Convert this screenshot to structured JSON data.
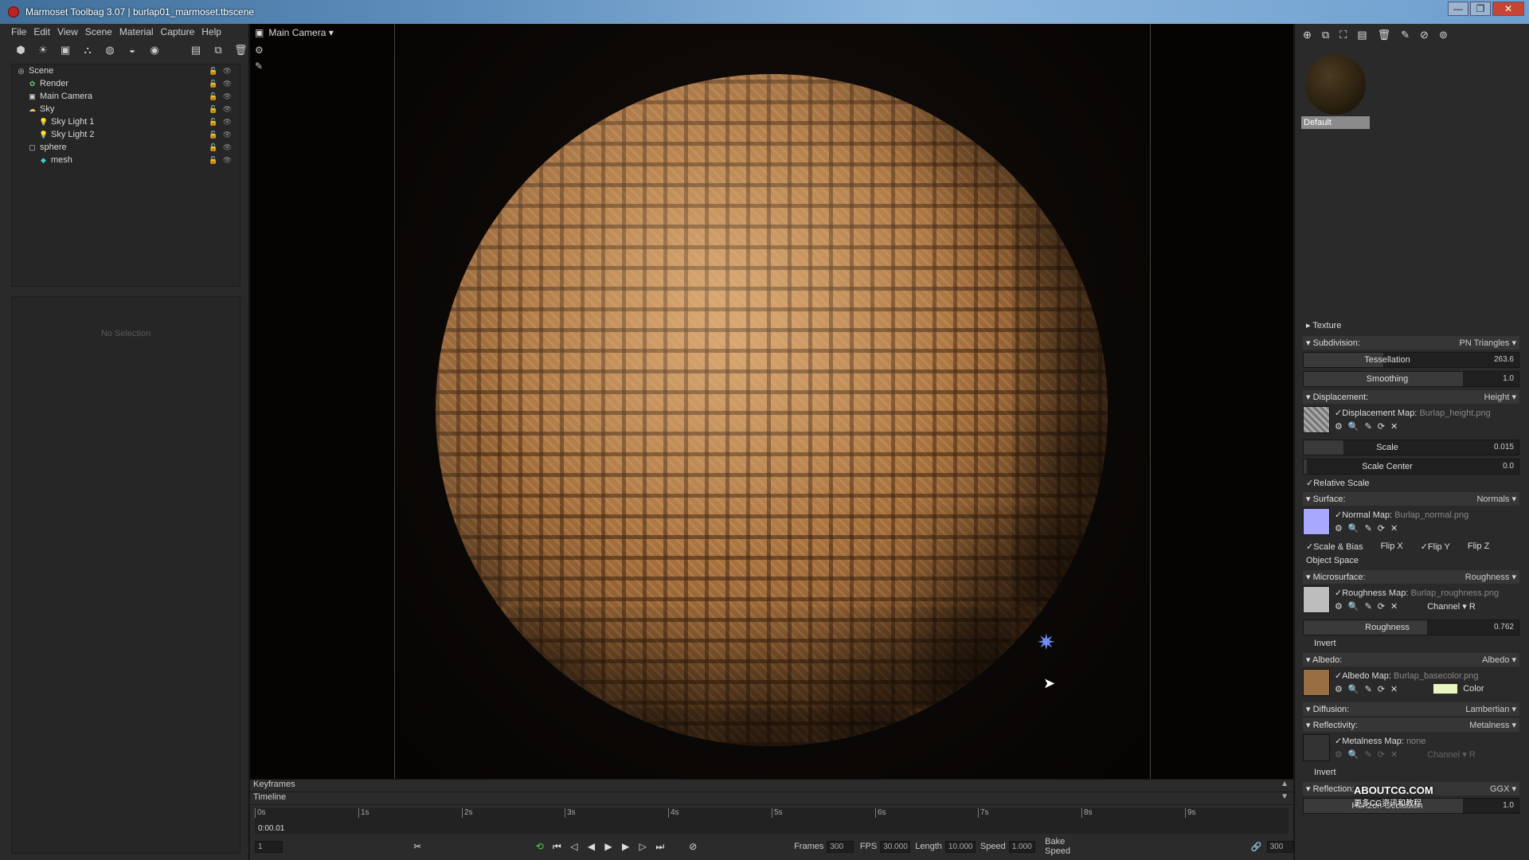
{
  "window": {
    "title": "Marmoset Toolbag 3.07  |  burlap01_marmoset.tbscene",
    "minimize": "—",
    "maximize": "❐",
    "close": "✕"
  },
  "menu": [
    "File",
    "Edit",
    "View",
    "Scene",
    "Material",
    "Capture",
    "Help"
  ],
  "scene_tree": [
    {
      "name": "Scene",
      "depth": 0,
      "icon": "scene-icon"
    },
    {
      "name": "Render",
      "depth": 1,
      "icon": "render-icon"
    },
    {
      "name": "Main Camera",
      "depth": 1,
      "icon": "camera-icon"
    },
    {
      "name": "Sky",
      "depth": 1,
      "icon": "sky-icon"
    },
    {
      "name": "Sky Light 1",
      "depth": 2,
      "icon": "light-icon"
    },
    {
      "name": "Sky Light 2",
      "depth": 2,
      "icon": "light-icon"
    },
    {
      "name": "sphere",
      "depth": 1,
      "icon": "object-icon"
    },
    {
      "name": "mesh",
      "depth": 2,
      "icon": "mesh-icon"
    }
  ],
  "detail": {
    "empty_text": "No Selection"
  },
  "viewport": {
    "camera_label": "Main Camera ▾"
  },
  "timeline": {
    "keyframes_label": "Keyframes",
    "timeline_label": "Timeline",
    "ticks": [
      "0s",
      "1s",
      "2s",
      "3s",
      "4s",
      "5s",
      "6s",
      "7s",
      "8s",
      "9s"
    ],
    "current_time": "0:00.01",
    "frame_field": "1",
    "frames_label": "Frames",
    "frames_value": "300",
    "fps_label": "FPS",
    "fps_value": "30.000",
    "length_label": "Length",
    "length_value": "10.000",
    "speed_label": "Speed",
    "speed_value": "1.000",
    "bake_speed_label": "Bake Speed",
    "end_frame": "300"
  },
  "material": {
    "name": "Default"
  },
  "props": {
    "texture_label": "Texture",
    "subdivision": {
      "label": "Subdivision:",
      "value": "PN Triangles ▾",
      "tessellation_label": "Tessellation",
      "tessellation_value": "263.6",
      "smoothing_label": "Smoothing",
      "smoothing_value": "1.0"
    },
    "displacement": {
      "label": "Displacement:",
      "value": "Height ▾",
      "map_label": "✓Displacement Map:",
      "map_file": "Burlap_height.png",
      "scale_label": "Scale",
      "scale_value": "0.015",
      "scale_center_label": "Scale Center",
      "scale_center_value": "0.0",
      "relative_scale": "✓Relative Scale"
    },
    "surface": {
      "label": "Surface:",
      "value": "Normals ▾",
      "map_label": "✓Normal Map:",
      "map_file": "Burlap_normal.png",
      "scale_bias": "✓Scale & Bias",
      "flip_x": "Flip X",
      "flip_y": "✓Flip Y",
      "flip_z": "Flip Z",
      "object_space": "Object Space"
    },
    "microsurface": {
      "label": "Microsurface:",
      "value": "Roughness ▾",
      "map_label": "✓Roughness Map:",
      "map_file": "Burlap_roughness.png",
      "channel": "Channel ▾ R",
      "roughness_label": "Roughness",
      "roughness_value": "0.762",
      "invert": "Invert"
    },
    "albedo": {
      "label": "Albedo:",
      "value": "Albedo ▾",
      "map_label": "✓Albedo Map:",
      "map_file": "Burlap_basecolor.png",
      "color_label": "Color"
    },
    "diffusion": {
      "label": "Diffusion:",
      "value": "Lambertian ▾"
    },
    "reflectivity": {
      "label": "Reflectivity:",
      "value": "Metalness ▾",
      "map_label": "✓Metalness Map:",
      "map_file": "none",
      "channel": "Channel ▾ R",
      "invert": "Invert"
    },
    "reflection": {
      "label": "Reflection:",
      "value": "GGX ▾",
      "horizon_label": "Horizon Occlusion",
      "horizon_value": "1.0"
    }
  },
  "watermark": {
    "brand": "ABOUTCG.COM",
    "sub": "更多CG资讯和教程"
  },
  "colors": {
    "normal_swatch": "#a9a8ff",
    "albedo_swatch": "#9a6e43",
    "albedo_color": "#e8f5c0"
  }
}
